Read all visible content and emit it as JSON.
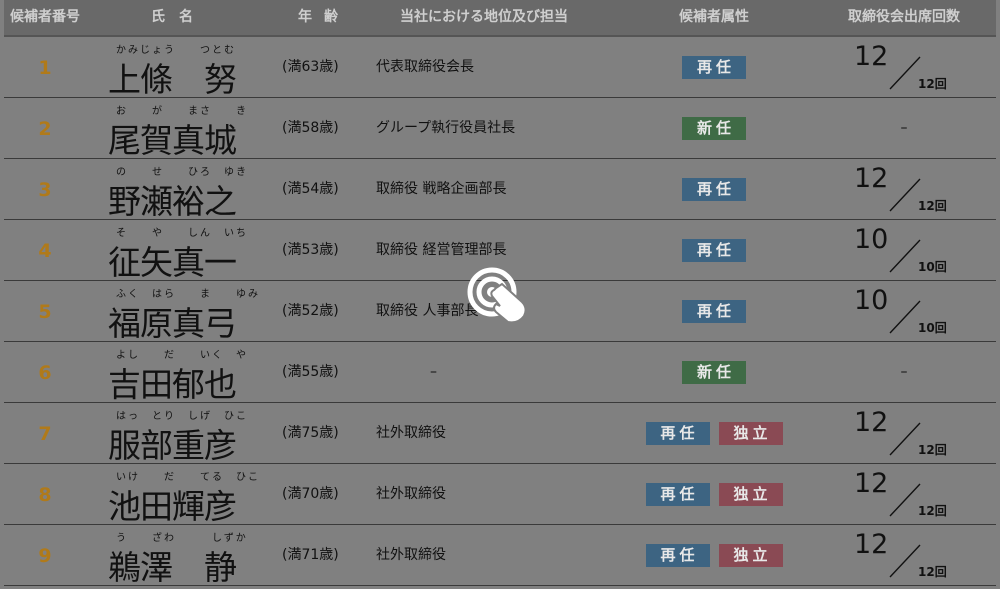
{
  "header": {
    "no": "候補者番号",
    "name": "氏名",
    "age": "年齢",
    "position": "当社における地位及び担当",
    "attribute": "候補者属性",
    "attendance": "取締役会出席回数"
  },
  "rows": [
    {
      "no": "1",
      "furigana": "かみじょう　　つとむ",
      "name": "上條　努",
      "age": "(満63歳)",
      "position": "代表取締役会長",
      "badges": [
        "再任"
      ],
      "att_num": "12",
      "att_den": "12回"
    },
    {
      "no": "2",
      "furigana": "お　　が　　まさ　　き",
      "name": "尾賀真城",
      "age": "(満58歳)",
      "position": "グループ執行役員社長",
      "badges": [
        "新任"
      ],
      "att_dash": "–"
    },
    {
      "no": "3",
      "furigana": "の　　せ　　ひろ　ゆき",
      "name": "野瀬裕之",
      "age": "(満54歳)",
      "position": "取締役 戦略企画部長",
      "badges": [
        "再任"
      ],
      "att_num": "12",
      "att_den": "12回"
    },
    {
      "no": "4",
      "furigana": "そ　　や　　しん　いち",
      "name": "征矢真一",
      "age": "(満53歳)",
      "position": "取締役 経営管理部長",
      "badges": [
        "再任"
      ],
      "att_num": "10",
      "att_den": "10回"
    },
    {
      "no": "5",
      "furigana": "ふく　はら　　ま　　ゆみ",
      "name": "福原真弓",
      "age": "(満52歳)",
      "position": "取締役 人事部長",
      "badges": [
        "再任"
      ],
      "att_num": "10",
      "att_den": "10回"
    },
    {
      "no": "6",
      "furigana": "よし　　だ　　いく　や",
      "name": "吉田郁也",
      "age": "(満55歳)",
      "position": "–",
      "badges": [
        "新任"
      ],
      "att_dash": "–"
    },
    {
      "no": "7",
      "furigana": "はっ　とり　しげ　ひこ",
      "name": "服部重彦",
      "age": "(満75歳)",
      "position": "社外取締役",
      "badges": [
        "再任",
        "独立"
      ],
      "att_num": "12",
      "att_den": "12回"
    },
    {
      "no": "8",
      "furigana": "いけ　　だ　　てる　ひこ",
      "name": "池田輝彦",
      "age": "(満70歳)",
      "position": "社外取締役",
      "badges": [
        "再任",
        "独立"
      ],
      "att_num": "12",
      "att_den": "12回"
    },
    {
      "no": "9",
      "furigana": "う　　ざわ　　　しずか",
      "name": "鵜澤　静",
      "age": "(満71歳)",
      "position": "社外取締役",
      "badges": [
        "再任",
        "独立"
      ],
      "att_num": "12",
      "att_den": "12回"
    }
  ],
  "colors": {
    "reappoint": "#3d6482",
    "new": "#3f6b46",
    "independent": "#8a4a54",
    "number": "#b07a1a"
  },
  "cursor_icon": "tap-hand-icon"
}
